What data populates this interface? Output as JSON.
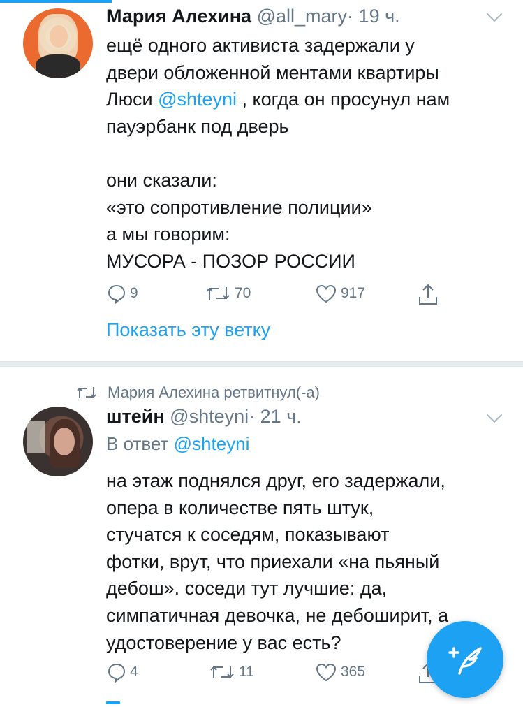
{
  "tweet1": {
    "author_name": "Мария Алехина",
    "handle": "@all_mary",
    "separator": "·",
    "time": "19 ч.",
    "text_a": "ещё одного активиста задержали у\nдвери обложенной ментами  квартиры\nЛюси ",
    "mention": "@shteyni",
    "text_b": " , когда он просунул нам\nпауэрбанк под дверь\n\nони сказали:\n«это сопротивление полиции»\nа мы говорим:\nМУСОРА - ПОЗОР РОССИИ",
    "replies": "9",
    "retweets": "70",
    "likes": "917",
    "show_thread": "Показать эту ветку"
  },
  "tweet2": {
    "retweeted_by": "Мария Алехина ретвитнул(-а)",
    "author_name": "штейн",
    "handle": "@shteyni",
    "separator": "·",
    "time": "21 ч.",
    "reply_prefix": "В ответ ",
    "reply_mention": "@shteyni",
    "text": "на этаж поднялся друг, его задержали,\nопера в количестве пять штук,\nстучатся к соседям, показывают\nфотки, врут, что приехали «на пьяный\nдебош». соседи тут лучшие: да,\nсимпатичная девочка, не дебоширит, а\nудостоверение у вас есть?",
    "replies": "4",
    "retweets": "11",
    "likes": "365"
  },
  "compose_icon": "compose-feather-icon",
  "accent_color": "#1da1f2"
}
